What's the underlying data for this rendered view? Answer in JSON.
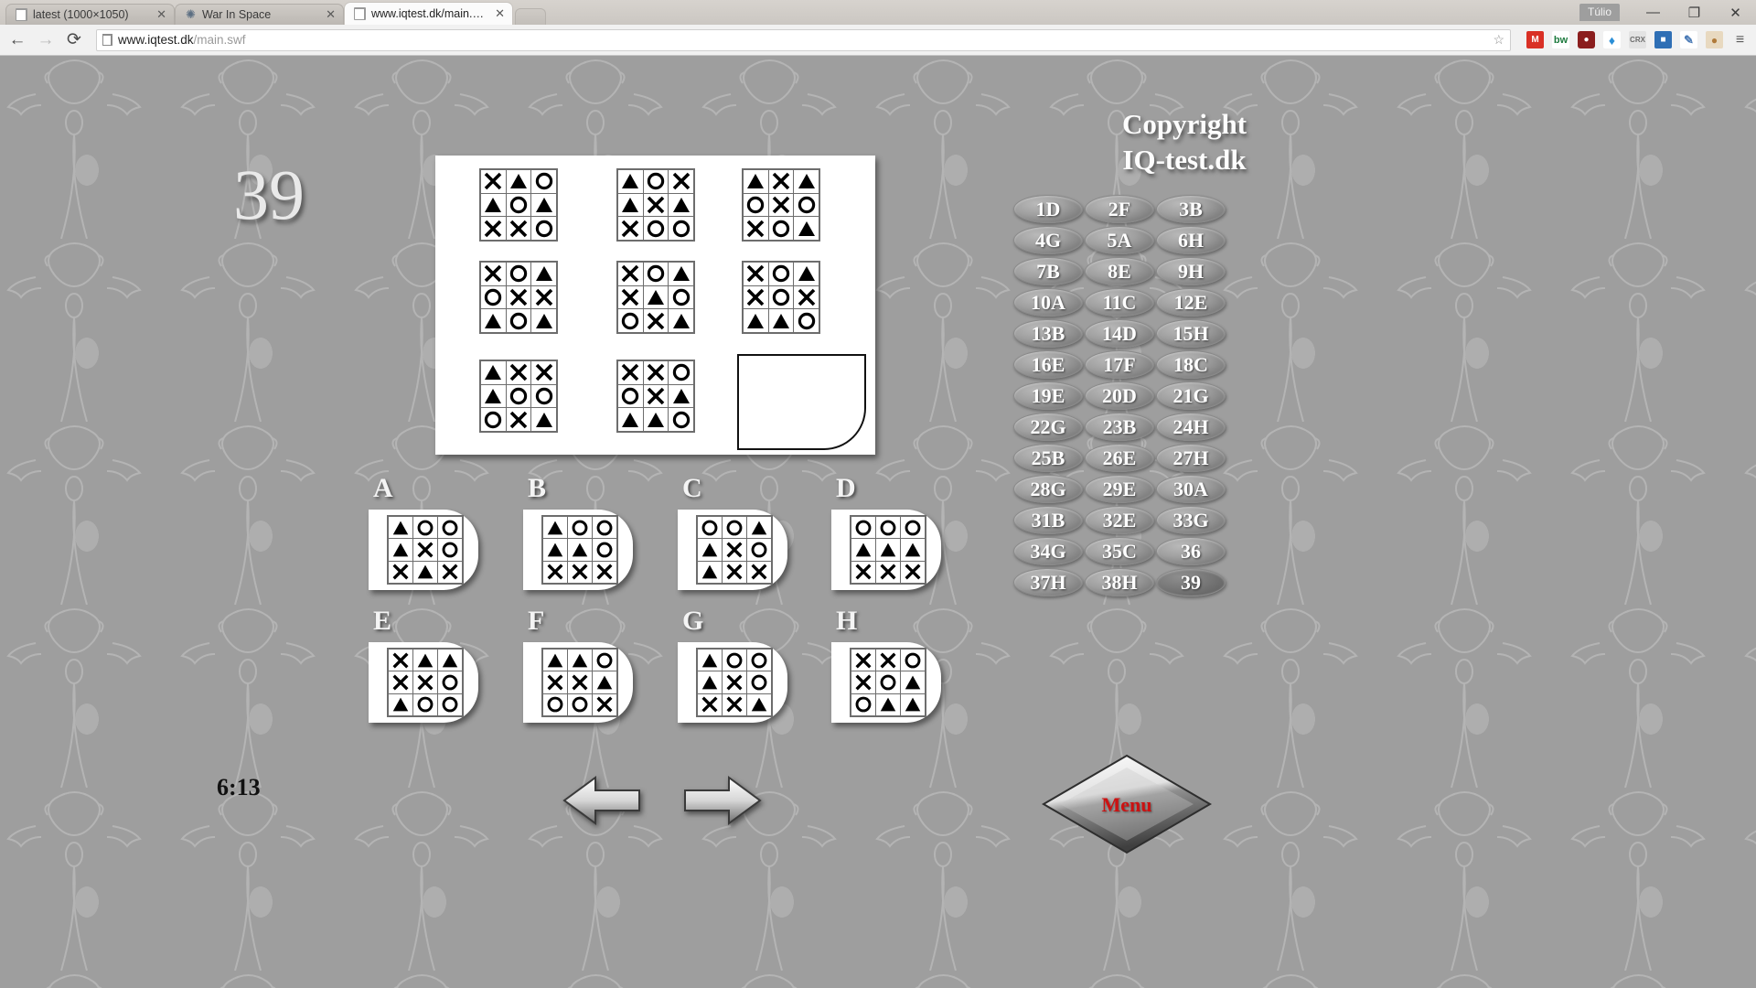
{
  "browser": {
    "tabs": [
      {
        "title": "latest (1000×1050)",
        "icon": "document-icon",
        "active": false
      },
      {
        "title": "War In Space",
        "icon": "star-icon",
        "active": false
      },
      {
        "title": "www.iqtest.dk/main.swf",
        "icon": "document-icon",
        "active": true
      }
    ],
    "close_label": "✕",
    "profile_label": "Túlio",
    "window": {
      "minimize": "—",
      "maximize": "❐",
      "close": "✕"
    },
    "nav": {
      "back": "←",
      "forward": "→",
      "reload": "⟳"
    },
    "address": {
      "domain": "www.iqtest.dk",
      "path": "/main.swf",
      "bookmark_icon": "star-icon"
    },
    "extensions": [
      {
        "name": "gmail-icon",
        "glyph": "M",
        "color": "#d93025"
      },
      {
        "name": "bitwarden-icon",
        "glyph": "bw",
        "color": "#1d7a3e"
      },
      {
        "name": "ublock-icon",
        "glyph": "ⓤ",
        "color": "#8b1e1e"
      },
      {
        "name": "water-drop-icon",
        "glyph": "◆",
        "color": "#2a8ed6"
      },
      {
        "name": "crx-icon",
        "glyph": "CRX",
        "color": "#6d6d6d"
      },
      {
        "name": "screenshot-icon",
        "glyph": "■",
        "color": "#2f6fb5"
      },
      {
        "name": "notes-icon",
        "glyph": "✎",
        "color": "#4a7ab5"
      },
      {
        "name": "palette-icon",
        "glyph": "●",
        "color": "#b07a3a"
      },
      {
        "name": "chrome-menu-icon",
        "glyph": "≡",
        "color": "#5a5a5a"
      }
    ]
  },
  "test": {
    "question_number": "39",
    "timer": "6:13",
    "copyright_line1": "Copyright",
    "copyright_line2": "IQ-test.dk",
    "menu_label": "Menu",
    "prev_arrow": "left-arrow-icon",
    "next_arrow": "right-arrow-icon",
    "matrix": [
      [
        [
          "X",
          "T",
          "O"
        ],
        [
          "T",
          "O",
          "T"
        ],
        [
          "X",
          "X",
          "O"
        ]
      ],
      [
        [
          "T",
          "O",
          "X"
        ],
        [
          "T",
          "X",
          "T"
        ],
        [
          "X",
          "O",
          "O"
        ]
      ],
      [
        [
          "T",
          "X",
          "T"
        ],
        [
          "O",
          "X",
          "O"
        ],
        [
          "X",
          "O",
          "T"
        ]
      ],
      [
        [
          "X",
          "O",
          "T"
        ],
        [
          "O",
          "X",
          "X"
        ],
        [
          "T",
          "O",
          "T"
        ]
      ],
      [
        [
          "X",
          "O",
          "T"
        ],
        [
          "X",
          "T",
          "O"
        ],
        [
          "O",
          "X",
          "T"
        ]
      ],
      [
        [
          "X",
          "O",
          "T"
        ],
        [
          "X",
          "O",
          "X"
        ],
        [
          "T",
          "T",
          "O"
        ]
      ],
      [
        [
          "T",
          "X",
          "X"
        ],
        [
          "T",
          "O",
          "O"
        ],
        [
          "O",
          "X",
          "T"
        ]
      ],
      [
        [
          "X",
          "X",
          "O"
        ],
        [
          "O",
          "X",
          "T"
        ],
        [
          "T",
          "T",
          "O"
        ]
      ],
      null
    ],
    "options": [
      {
        "label": "A",
        "grid": [
          [
            "T",
            "O",
            "O"
          ],
          [
            "T",
            "X",
            "O"
          ],
          [
            "X",
            "T",
            "X"
          ]
        ]
      },
      {
        "label": "B",
        "grid": [
          [
            "T",
            "O",
            "O"
          ],
          [
            "T",
            "T",
            "O"
          ],
          [
            "X",
            "X",
            "X"
          ]
        ]
      },
      {
        "label": "C",
        "grid": [
          [
            "O",
            "O",
            "T"
          ],
          [
            "T",
            "X",
            "O"
          ],
          [
            "T",
            "X",
            "X"
          ]
        ]
      },
      {
        "label": "D",
        "grid": [
          [
            "O",
            "O",
            "O"
          ],
          [
            "T",
            "T",
            "T"
          ],
          [
            "X",
            "X",
            "X"
          ]
        ]
      },
      {
        "label": "E",
        "grid": [
          [
            "X",
            "T",
            "T"
          ],
          [
            "X",
            "X",
            "O"
          ],
          [
            "T",
            "O",
            "O"
          ]
        ]
      },
      {
        "label": "F",
        "grid": [
          [
            "T",
            "T",
            "O"
          ],
          [
            "X",
            "X",
            "T"
          ],
          [
            "O",
            "O",
            "X"
          ]
        ]
      },
      {
        "label": "G",
        "grid": [
          [
            "T",
            "O",
            "O"
          ],
          [
            "T",
            "X",
            "O"
          ],
          [
            "X",
            "X",
            "T"
          ]
        ]
      },
      {
        "label": "H",
        "grid": [
          [
            "X",
            "X",
            "O"
          ],
          [
            "X",
            "O",
            "T"
          ],
          [
            "O",
            "T",
            "T"
          ]
        ]
      }
    ],
    "answered": [
      {
        "label": "1D"
      },
      {
        "label": "2F"
      },
      {
        "label": "3B"
      },
      {
        "label": "4G"
      },
      {
        "label": "5A"
      },
      {
        "label": "6H"
      },
      {
        "label": "7B"
      },
      {
        "label": "8E"
      },
      {
        "label": "9H"
      },
      {
        "label": "10A"
      },
      {
        "label": "11C"
      },
      {
        "label": "12E"
      },
      {
        "label": "13B"
      },
      {
        "label": "14D"
      },
      {
        "label": "15H"
      },
      {
        "label": "16E"
      },
      {
        "label": "17F"
      },
      {
        "label": "18C"
      },
      {
        "label": "19E"
      },
      {
        "label": "20D"
      },
      {
        "label": "21G"
      },
      {
        "label": "22G"
      },
      {
        "label": "23B"
      },
      {
        "label": "24H"
      },
      {
        "label": "25B"
      },
      {
        "label": "26E"
      },
      {
        "label": "27H"
      },
      {
        "label": "28G"
      },
      {
        "label": "29E"
      },
      {
        "label": "30A"
      },
      {
        "label": "31B"
      },
      {
        "label": "32E"
      },
      {
        "label": "33G"
      },
      {
        "label": "34G"
      },
      {
        "label": "35C"
      },
      {
        "label": "36"
      },
      {
        "label": "37H"
      },
      {
        "label": "38H"
      },
      {
        "label": "39",
        "current": true
      }
    ]
  }
}
